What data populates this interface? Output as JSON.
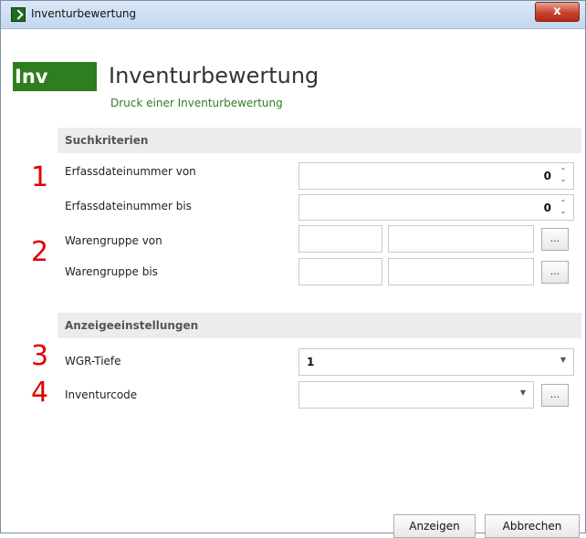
{
  "window": {
    "title": "Inventurbewertung",
    "close_label": "x"
  },
  "header": {
    "badge": "Inv",
    "title": "Inventurbewertung",
    "subtitle": "Druck einer Inventurbewertung"
  },
  "sections": {
    "search": "Suchkriterien",
    "display": "Anzeigeeinstellungen"
  },
  "markers": [
    "1",
    "2",
    "3",
    "4"
  ],
  "fields": {
    "erfass_von": {
      "label": "Erfassdateinummer von",
      "value": "0"
    },
    "erfass_bis": {
      "label": "Erfassdateinummer bis",
      "value": "0"
    },
    "wg_von": {
      "label": "Warengruppe von",
      "value_a": "",
      "value_b": ""
    },
    "wg_bis": {
      "label": "Warengruppe bis",
      "value_a": "",
      "value_b": ""
    },
    "wgr_tiefe": {
      "label": "WGR-Tiefe",
      "value": "1"
    },
    "inventurcode": {
      "label": "Inventurcode",
      "value": ""
    }
  },
  "icons": {
    "spin_up": "⌃",
    "spin_down": "⌄",
    "dropdown": "▼",
    "browse": "..."
  },
  "buttons": {
    "show": "Anzeigen",
    "cancel": "Abbrechen"
  },
  "colors": {
    "accent_green": "#2e7d1e",
    "marker_red": "#e00000"
  }
}
